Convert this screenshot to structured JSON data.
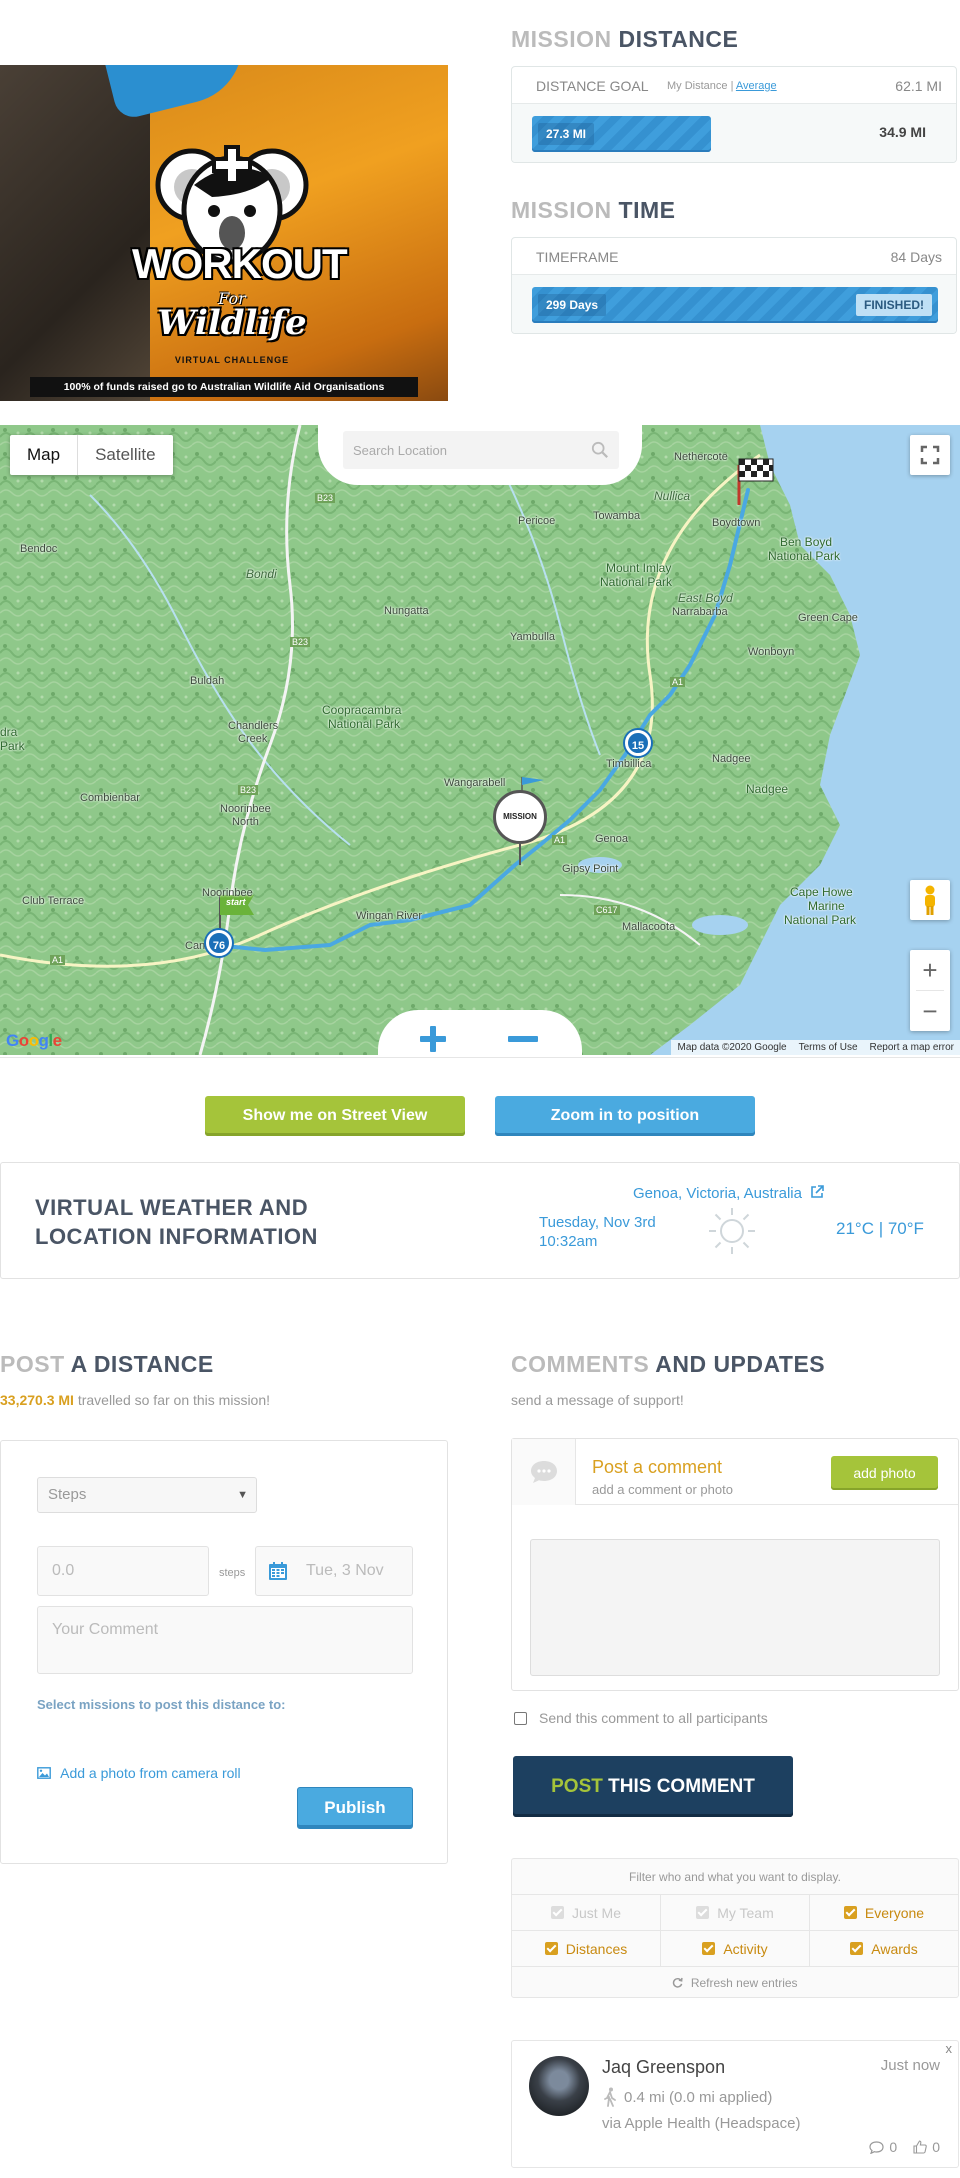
{
  "banner": {
    "title_line1": "WORKOUT",
    "title_for": "For",
    "title_line2": "Wildlife",
    "subtitle": "VIRTUAL CHALLENGE",
    "footer": "100% of funds raised go to Australian Wildlife Aid Organisations"
  },
  "distance": {
    "title_lite": "MISSION",
    "title_dark": "DISTANCE",
    "goal_label": "DISTANCE GOAL",
    "my_distance": "My Distance |",
    "average_link": "Average",
    "goal_value": "62.1 MI",
    "progress_value": "27.3 MI",
    "remaining_value": "34.9 MI",
    "progress_fraction": 0.44
  },
  "time": {
    "title_lite": "MISSION",
    "title_dark": "TIME",
    "timeframe_label": "TIMEFRAME",
    "timeframe_value": "84 Days",
    "progress_value": "299 Days",
    "status": "FINISHED!",
    "progress_fraction": 1.0
  },
  "map": {
    "type_map": "Map",
    "type_satellite": "Satellite",
    "search_placeholder": "Search Location",
    "zoom_in": "+",
    "zoom_out": "−",
    "attr_data": "Map data ©2020 Google",
    "attr_terms": "Terms of Use",
    "attr_report": "Report a map error",
    "google": "Google",
    "marker_76": "76",
    "marker_15": "15",
    "start_flag": "start",
    "mission_pin": "MISSION",
    "labels": {
      "bendoc": "Bendoc",
      "bondi": "Bondi",
      "nungatta": "Nungatta",
      "buldah": "Buldah",
      "chandlers": "Chandlers",
      "creek": "Creek",
      "coopracambra": "Coopracambra",
      "coopracambra_np": "National Park",
      "combienbar": "Combienbar",
      "noorinbee": "Noorinbee",
      "north": "North",
      "club_terrace": "Club Terrace",
      "noorinbee2": "Noorinbee",
      "cann": "Cann",
      "wingan": "Wingan River",
      "wangarabell": "Wangarabell",
      "genoa": "Genoa",
      "gipsy": "Gipsy Point",
      "mallacoota": "Mallacoota",
      "timbillica": "Timbillica",
      "nadgee1": "Nadgee",
      "nadgee2": "Nadgee",
      "yambulla": "Yambulla",
      "pericoe": "Pericoe",
      "towamba": "Towamba",
      "nethercote": "Nethercote",
      "nullica": "Nullica",
      "boydtown": "Boydtown",
      "ben_boyd": "Ben Boyd",
      "ben_boyd_np": "National Park",
      "mount_imlay": "Mount Imlay",
      "mount_imlay_np": "National Park",
      "east_boyd": "East Boyd",
      "green_cape": "Green Cape",
      "narrabarba": "Narrabarba",
      "wonboyn": "Wonboyn",
      "cape_howe": "Cape Howe",
      "cape_howe_2": "Marine",
      "cape_howe_3": "National Park",
      "dra": "dra",
      "park": "Park",
      "b23a": "B23",
      "b23b": "B23",
      "b23c": "B23",
      "a1a": "A1",
      "a1b": "A1",
      "a1c": "A1",
      "c617": "C617"
    }
  },
  "actions": {
    "street_view": "Show me on Street View",
    "zoom_position": "Zoom in to position"
  },
  "weather": {
    "title_line1": "VIRTUAL WEATHER AND",
    "title_line2": "LOCATION INFORMATION",
    "location": "Genoa, Victoria, Australia",
    "date": "Tuesday, Nov 3rd",
    "time": "10:32am",
    "temperature": "21°C | 70°F"
  },
  "post": {
    "title_lite": "POST",
    "title_dark": "A DISTANCE",
    "total_value": "33,270.3 MI",
    "total_suffix": "travelled so far on this mission!",
    "unit_selected": "Steps",
    "distance_placeholder": "0.0",
    "distance_unit": "steps",
    "date_placeholder": "Tue, 3 Nov",
    "comment_placeholder": "Your Comment",
    "select_missions": "Select missions to post this distance to:",
    "add_photo": "Add a photo from camera roll",
    "publish": "Publish"
  },
  "comments": {
    "title_lite": "COMMENTS",
    "title_dark": "AND UPDATES",
    "subtitle": "send a message of support!",
    "post_title": "Post a comment",
    "post_sub": "add a comment or photo",
    "add_photo_btn": "add photo",
    "send_all": "Send this comment to all participants",
    "post_btn_accent": "POST",
    "post_btn_rest": "THIS COMMENT"
  },
  "filter": {
    "heading": "Filter who and what you want to display.",
    "just_me": "Just Me",
    "my_team": "My Team",
    "everyone": "Everyone",
    "distances": "Distances",
    "activity": "Activity",
    "awards": "Awards",
    "refresh": "Refresh new entries"
  },
  "entry": {
    "close": "x",
    "name": "Jaq Greenspon",
    "time": "Just now",
    "distance": "0.4 mi (0.0 mi applied)",
    "via": "via Apple Health (Headspace)",
    "comments_count": "0",
    "likes_count": "0"
  },
  "colors": {
    "accent_blue": "#3a9ad9",
    "accent_green": "#a5c43a",
    "accent_gold": "#d9a020",
    "navy": "#1d4060",
    "heading_dark": "#4a5565"
  }
}
